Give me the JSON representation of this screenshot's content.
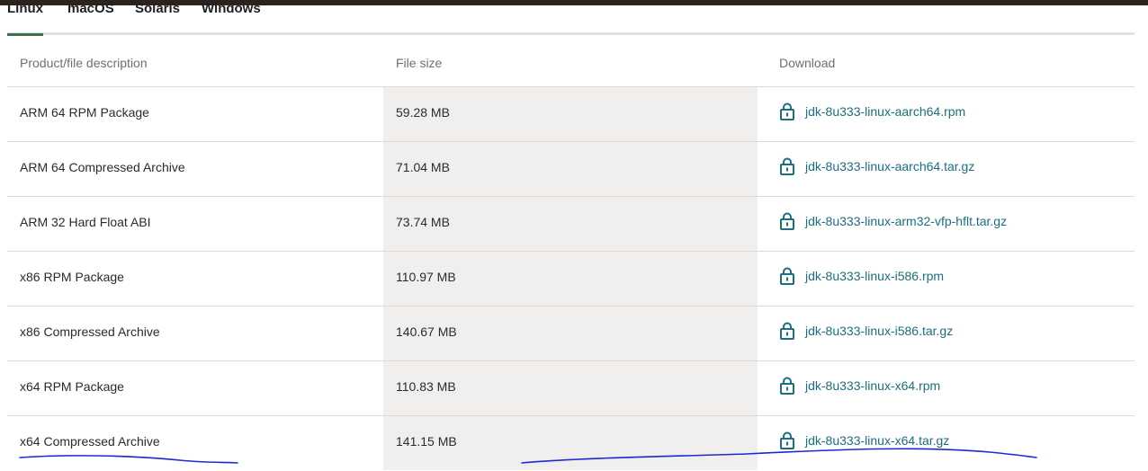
{
  "tabs": [
    {
      "label": "Linux",
      "active": true
    },
    {
      "label": "macOS",
      "active": false
    },
    {
      "label": "Solaris",
      "active": false
    },
    {
      "label": "Windows",
      "active": false
    }
  ],
  "table": {
    "headers": {
      "description": "Product/file description",
      "size": "File size",
      "download": "Download"
    },
    "rows": [
      {
        "description": "ARM 64 RPM Package",
        "size": "59.28 MB",
        "file": "jdk-8u333-linux-aarch64.rpm"
      },
      {
        "description": "ARM 64 Compressed Archive",
        "size": "71.04 MB",
        "file": "jdk-8u333-linux-aarch64.tar.gz"
      },
      {
        "description": "ARM 32 Hard Float ABI",
        "size": "73.74 MB",
        "file": "jdk-8u333-linux-arm32-vfp-hflt.tar.gz"
      },
      {
        "description": "x86 RPM Package",
        "size": "110.97 MB",
        "file": "jdk-8u333-linux-i586.rpm"
      },
      {
        "description": "x86 Compressed Archive",
        "size": "140.67 MB",
        "file": "jdk-8u333-linux-i586.tar.gz"
      },
      {
        "description": "x64 RPM Package",
        "size": "110.83 MB",
        "file": "jdk-8u333-linux-x64.rpm"
      },
      {
        "description": "x64 Compressed Archive",
        "size": "141.15 MB",
        "file": "jdk-8u333-linux-x64.tar.gz"
      }
    ]
  },
  "icons": {
    "download": "lock-icon"
  },
  "colors": {
    "accent": "#3f6e4a",
    "link": "#1b6f80",
    "size_column_bg": "#f1efed",
    "annotation": "#1d2bd6"
  }
}
